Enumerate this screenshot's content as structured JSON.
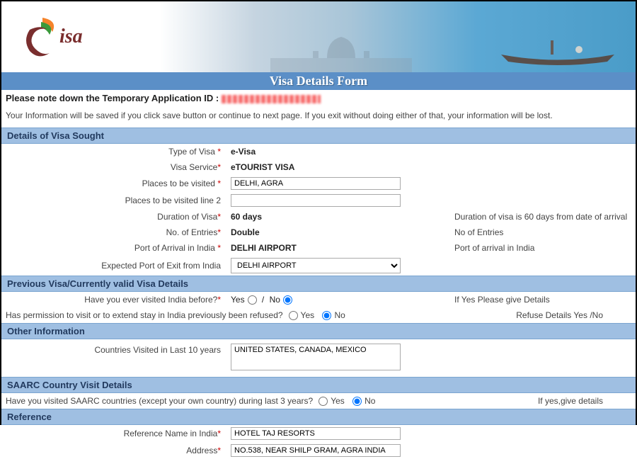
{
  "logo_text": "isa",
  "page_title": "Visa Details Form",
  "notice_prefix": "Please note down the Temporary Application ID : ",
  "info_text": "Your Information will be saved if you click save button or continue to next page. If you exit without doing either of that, your information will be lost.",
  "sections": {
    "visa_sought": "Details of Visa Sought",
    "prev_visa": "Previous Visa/Currently valid Visa Details",
    "other_info": "Other Information",
    "saarc": "SAARC Country Visit Details",
    "reference": "Reference"
  },
  "visa": {
    "type_label": "Type of Visa",
    "type_value": "e-Visa",
    "service_label": "Visa Service",
    "service_value": "eTOURIST VISA",
    "places_label": "Places to be visited",
    "places_value": "DELHI, AGRA",
    "places2_label": "Places to be visited line 2",
    "places2_value": "",
    "duration_label": "Duration of Visa",
    "duration_value": "60 days",
    "duration_hint": "Duration of visa is 60 days from date of arrival",
    "entries_label": "No. of Entries",
    "entries_value": "Double",
    "entries_hint": "No of Entries",
    "port_arrival_label": "Port of Arrival in India",
    "port_arrival_value": "DELHI AIRPORT",
    "port_arrival_hint": "Port of arrival in India",
    "port_exit_label": "Expected Port of Exit from India",
    "port_exit_value": "DELHI AIRPORT"
  },
  "prev": {
    "visited_label": "Have you ever visited India before?",
    "yes": "Yes",
    "no": "No",
    "visited_hint": "If Yes Please give Details",
    "refused_label": "Has permission to visit or to extend stay in India previously been refused?",
    "refused_hint": "Refuse Details Yes /No"
  },
  "other": {
    "countries_label": "Countries Visited in Last 10 years",
    "countries_value": "UNITED STATES, CANADA, MEXICO"
  },
  "saarc": {
    "q_label": "Have you visited SAARC countries (except your own country) during last 3 years?",
    "yes": "Yes",
    "no": "No",
    "hint": "If yes,give details"
  },
  "ref": {
    "name_label": "Reference Name in India",
    "name_value": "HOTEL TAJ RESORTS",
    "addr_label": "Address",
    "addr_value": "NO.538, NEAR SHILP GRAM, AGRA INDIA"
  }
}
